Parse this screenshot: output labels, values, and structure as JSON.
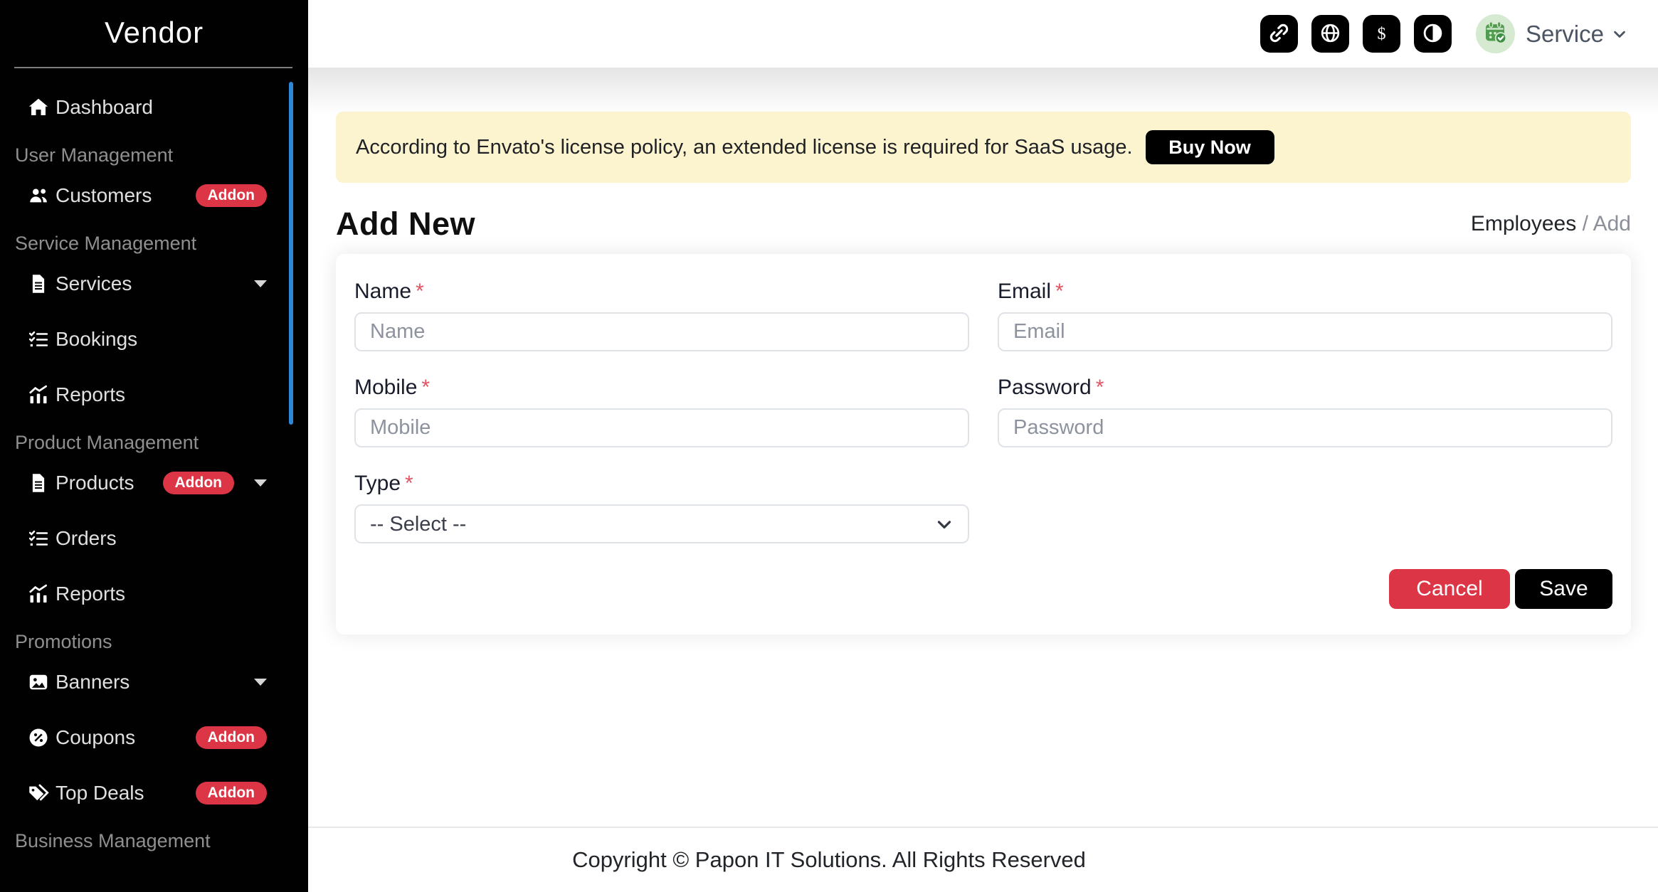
{
  "sidebar": {
    "brand": "Vendor",
    "items": [
      {
        "type": "link",
        "label": "Dashboard",
        "icon": "house-icon"
      },
      {
        "type": "header",
        "label": "User Management"
      },
      {
        "type": "link",
        "label": "Customers",
        "icon": "users-icon",
        "badge": "Addon"
      },
      {
        "type": "header",
        "label": "Service Management"
      },
      {
        "type": "link",
        "label": "Services",
        "icon": "file-lines-icon",
        "caret": true
      },
      {
        "type": "link",
        "label": "Bookings",
        "icon": "list-check-icon"
      },
      {
        "type": "link",
        "label": "Reports",
        "icon": "chart-icon"
      },
      {
        "type": "header",
        "label": "Product Management"
      },
      {
        "type": "link",
        "label": "Products",
        "icon": "file-lines-icon",
        "badge": "Addon",
        "caret": true
      },
      {
        "type": "link",
        "label": "Orders",
        "icon": "list-check-icon"
      },
      {
        "type": "link",
        "label": "Reports",
        "icon": "chart-icon"
      },
      {
        "type": "header",
        "label": "Promotions"
      },
      {
        "type": "link",
        "label": "Banners",
        "icon": "image-icon",
        "caret": true
      },
      {
        "type": "link",
        "label": "Coupons",
        "icon": "badge-percent-icon",
        "badge": "Addon"
      },
      {
        "type": "link",
        "label": "Top Deals",
        "icon": "tags-icon",
        "badge": "Addon"
      },
      {
        "type": "header",
        "label": "Business Management"
      }
    ]
  },
  "header": {
    "icon_buttons": [
      "link-icon",
      "globe-icon",
      "dollar-icon",
      "contrast-icon"
    ],
    "profile": {
      "name": "Service",
      "avatar_icon": "calendar-check-icon"
    }
  },
  "license_banner": {
    "text": "According to Envato's license policy, an extended license is required for SaaS usage.",
    "button_label": "Buy Now"
  },
  "page": {
    "title": "Add New",
    "breadcrumb": {
      "parent": "Employees",
      "separator": "/",
      "current": "Add"
    }
  },
  "form": {
    "required_mark": "*",
    "name": {
      "label": "Name",
      "placeholder": "Name"
    },
    "email": {
      "label": "Email",
      "placeholder": "Email"
    },
    "mobile": {
      "label": "Mobile",
      "placeholder": "Mobile"
    },
    "password": {
      "label": "Password",
      "placeholder": "Password"
    },
    "type": {
      "label": "Type",
      "selected_option": "-- Select --"
    },
    "buttons": {
      "cancel": "Cancel",
      "save": "Save"
    }
  },
  "footer": {
    "text": "Copyright © Papon IT Solutions. All Rights Reserved"
  },
  "colors": {
    "accent_red": "#dc3545",
    "scrollbar_blue": "#2d87d8",
    "banner_yellow": "#fcf3cf",
    "avatar_green_bg": "#d6ead1",
    "avatar_green_icon": "#519c4f",
    "sidebar_bg": "#010101",
    "button_black": "#000000"
  }
}
